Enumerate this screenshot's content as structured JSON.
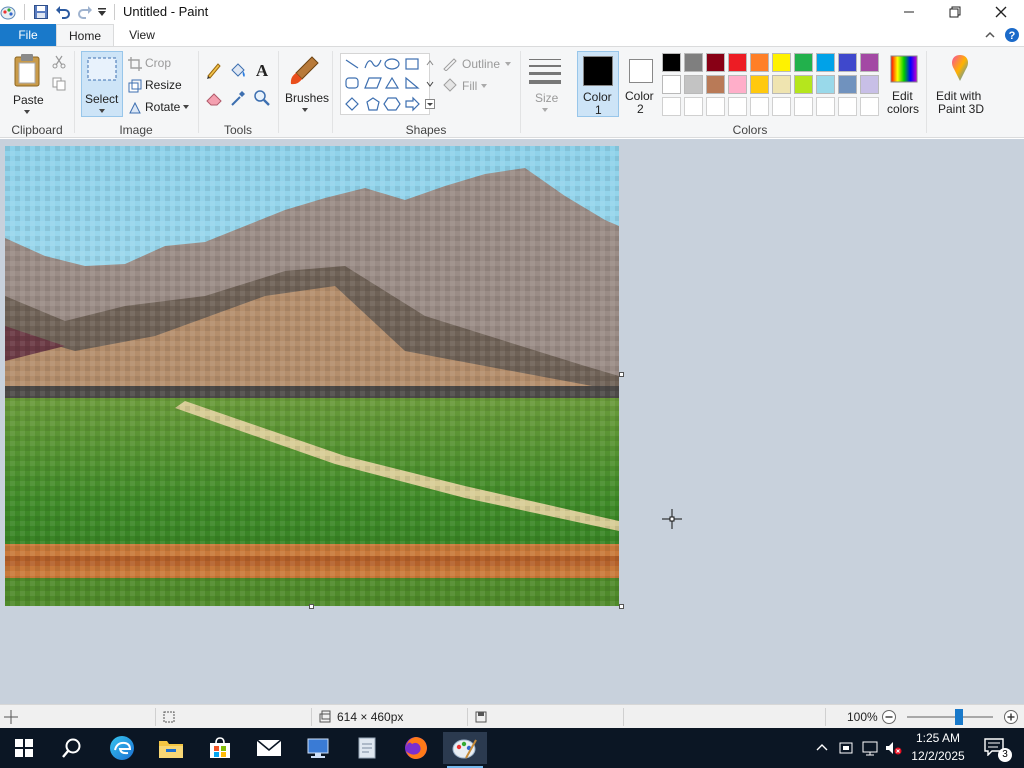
{
  "window": {
    "title": "Untitled - Paint"
  },
  "tabs": {
    "file": "File",
    "home": "Home",
    "view": "View"
  },
  "clipboard": {
    "paste": "Paste",
    "group": "Clipboard"
  },
  "image": {
    "select": "Select",
    "crop": "Crop",
    "resize": "Resize",
    "rotate": "Rotate",
    "group": "Image"
  },
  "tools": {
    "group": "Tools"
  },
  "brushes": {
    "label": "Brushes"
  },
  "shapes": {
    "outline": "Outline",
    "fill": "Fill",
    "group": "Shapes"
  },
  "size": {
    "label": "Size"
  },
  "colors": {
    "color1": "Color",
    "color1_num": "1",
    "color2": "Color",
    "color2_num": "2",
    "edit": "Edit",
    "edit2": "colors",
    "paint3d": "Edit with",
    "paint3d2": "Paint 3D",
    "group": "Colors",
    "palette_row1": [
      "#000000",
      "#7f7f7f",
      "#880015",
      "#ed1c24",
      "#ff7f27",
      "#fff200",
      "#22b14c",
      "#00a2e8",
      "#3f48cc",
      "#a349a4"
    ],
    "palette_row2": [
      "#ffffff",
      "#c3c3c3",
      "#b97a57",
      "#ffaec9",
      "#ffc90e",
      "#efe4b0",
      "#b5e61d",
      "#99d9ea",
      "#7092be",
      "#c8bfe7"
    ],
    "current1": "#000000",
    "current2": "#ffffff"
  },
  "status": {
    "dimensions": "614 × 460px",
    "zoom": "100%",
    "zoom_level": 0.6
  },
  "taskbar": {
    "time": "1:25 AM",
    "date": "12/2/2025",
    "notifications": "3"
  }
}
